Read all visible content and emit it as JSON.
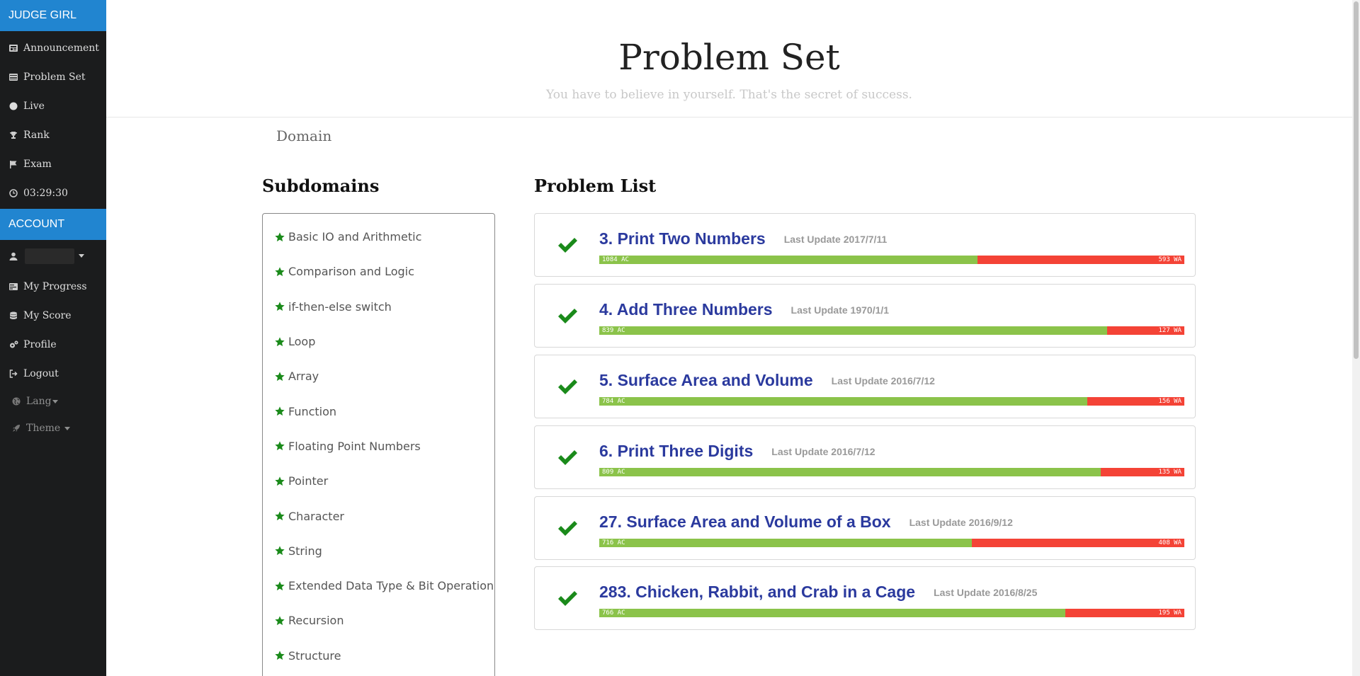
{
  "sidebar": {
    "brand": "JUDGE GIRL",
    "nav": [
      {
        "label": "Announcement",
        "icon": "newspaper-icon"
      },
      {
        "label": "Problem Set",
        "icon": "list-icon"
      },
      {
        "label": "Live",
        "icon": "circle-icon"
      },
      {
        "label": "Rank",
        "icon": "trophy-icon"
      },
      {
        "label": "Exam",
        "icon": "flag-icon"
      },
      {
        "label": "03:29:30",
        "icon": "clock-icon"
      }
    ],
    "account_header": "ACCOUNT",
    "account_items": [
      {
        "label": "My Progress",
        "icon": "tasks-icon"
      },
      {
        "label": "My Score",
        "icon": "database-icon"
      },
      {
        "label": "Profile",
        "icon": "cogs-icon"
      },
      {
        "label": "Logout",
        "icon": "sign-out-icon"
      }
    ],
    "lang": "Lang",
    "theme": "Theme"
  },
  "header": {
    "title": "Problem Set",
    "subtitle": "You have to believe in yourself. That's the secret of success."
  },
  "domain_tab": "Domain",
  "subdomains": {
    "title": "Subdomains",
    "items": [
      "Basic IO and Arithmetic",
      "Comparison and Logic",
      "if-then-else switch",
      "Loop",
      "Array",
      "Function",
      "Floating Point Numbers",
      "Pointer",
      "Character",
      "String",
      "Extended Data Type & Bit Operation",
      "Recursion",
      "Structure"
    ]
  },
  "problems": {
    "title": "Problem List",
    "items": [
      {
        "title": "3. Print Two Numbers",
        "date": "Last Update 2017/7/11",
        "ac": 1084,
        "wa": 593,
        "ac_label": "1084 AC",
        "wa_label": "593 WA"
      },
      {
        "title": "4. Add Three Numbers",
        "date": "Last Update 1970/1/1",
        "ac": 839,
        "wa": 127,
        "ac_label": "839 AC",
        "wa_label": "127 WA"
      },
      {
        "title": "5. Surface Area and Volume",
        "date": "Last Update 2016/7/12",
        "ac": 784,
        "wa": 156,
        "ac_label": "784 AC",
        "wa_label": "156 WA"
      },
      {
        "title": "6. Print Three Digits",
        "date": "Last Update 2016/7/12",
        "ac": 809,
        "wa": 135,
        "ac_label": "809 AC",
        "wa_label": "135 WA"
      },
      {
        "title": "27. Surface Area and Volume of a Box",
        "date": "Last Update 2016/9/12",
        "ac": 716,
        "wa": 408,
        "ac_label": "716 AC",
        "wa_label": "408 WA"
      },
      {
        "title": "283. Chicken, Rabbit, and Crab in a Cage",
        "date": "Last Update 2016/8/25",
        "ac": 766,
        "wa": 195,
        "ac_label": "766 AC",
        "wa_label": "195 WA"
      }
    ]
  },
  "colors": {
    "brand_blue": "#2185d0",
    "sidebar_bg": "#1b1c1d",
    "ac_green": "#8bc34a",
    "wa_red": "#f44336",
    "title_blue": "#2b3a9e",
    "check_green": "#1a8a1a"
  }
}
